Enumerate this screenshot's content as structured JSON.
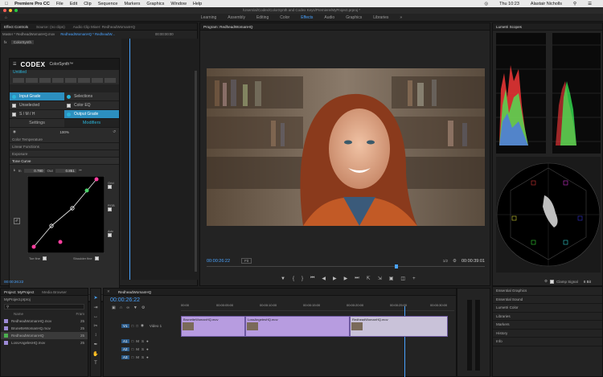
{
  "menubar": {
    "app": "Premiere Pro CC",
    "items": [
      "File",
      "Edit",
      "Clip",
      "Sequence",
      "Markers",
      "Graphics",
      "Window",
      "Help"
    ],
    "right": [
      "Thu 10:23",
      "Alastair Nicholls"
    ]
  },
  "titlebar": {
    "path": "/Users/al/Codex/ColorSynth and Codex Keys/Premiere/MyProject.prproj *"
  },
  "workspaces": {
    "items": [
      "Learning",
      "Assembly",
      "Editing",
      "Color",
      "Effects",
      "Audio",
      "Graphics",
      "Libraries"
    ],
    "active": "Effects"
  },
  "effect_panel": {
    "tabs": [
      "Effect Controls",
      "Source: (no clips)",
      "Audio Clip Mixer: RedheadWomanHQ",
      "RedheadWomanHQ"
    ],
    "master": "Master * RedheadWomanHQ.mov",
    "clip": "RedheadWomanHQ * RedheadW...",
    "fx_name": "ColorSynth",
    "timecode_head": "00:00:00:00",
    "timecode": "00:00:26:22",
    "plugin": {
      "brand": "CODEX",
      "product": "ColorSynth™",
      "preset": "Untitled",
      "grid": [
        {
          "left": "Input Grade",
          "right": "Selections",
          "left_type": "dot",
          "right_type": "dot",
          "left_sel": true
        },
        {
          "left": "Unselected",
          "right": "Color EQ",
          "left_type": "check",
          "right_type": "check"
        },
        {
          "left": "S / M / H",
          "right": "Output Grade",
          "left_type": "check",
          "right_type": "dot",
          "right_sel": true
        }
      ],
      "sub_tabs": [
        "Settings",
        "Modifiers"
      ],
      "active_sub_tab": "Modifiers",
      "amount": "100%",
      "sections": [
        "Color Temperature",
        "Linear Functions",
        "Exposure",
        "Tone Curve"
      ],
      "curve": {
        "in_label": "In",
        "in_value": "0.780",
        "out_label": "Out",
        "out_value": "0.851",
        "side_labels": [
          "Grid",
          "RGB",
          "Adv"
        ],
        "toe_label": "Toe fine",
        "shoulder_label": "Shoulder fine"
      },
      "footer": "Color Tone"
    }
  },
  "program": {
    "title": "Program: RedheadWomanHQ",
    "timecode": "00:00:26:22",
    "fit": "Fit",
    "resolution": "1/2",
    "duration": "00:00:39:01"
  },
  "scopes": {
    "title": "Lumetri Scopes",
    "signal_label": "Clamp Signal",
    "bit_depth": "8 Bit"
  },
  "project": {
    "tabs": [
      "Project: MyProject",
      "Media Browser"
    ],
    "file": "MyProject.prproj",
    "header_name": "Name",
    "header_rate": "Fram",
    "items": [
      {
        "name": "RedheadWomanHQ.mov",
        "rate": "25",
        "color": "#9c8ad6"
      },
      {
        "name": "BrunetteWomanHQ.mov",
        "rate": "25",
        "color": "#9c8ad6"
      },
      {
        "name": "RedheadWomanHQ",
        "rate": "25",
        "color": "#4caf50"
      },
      {
        "name": "LossAngelesHQ.mov",
        "rate": "25",
        "color": "#9c8ad6"
      }
    ]
  },
  "timeline": {
    "tab": "RedheadWomanHQ",
    "timecode": "00:00:26:22",
    "ruler": [
      "00:00",
      "00:00:05:00",
      "00:00:10:00",
      "00:00:15:00",
      "00:00:20:00",
      "00:00:25:00",
      "00:00:30:00"
    ],
    "track_label": "Video 1",
    "clips": [
      "BrunetteWomanHQ.mov",
      "LossAngelesHQ.mov",
      "RedheadWomanHQ.mov"
    ]
  },
  "right_panels": [
    "Essential Graphics",
    "Essential Sound",
    "Lumetri Color",
    "Libraries",
    "Markers",
    "History",
    "Info"
  ]
}
